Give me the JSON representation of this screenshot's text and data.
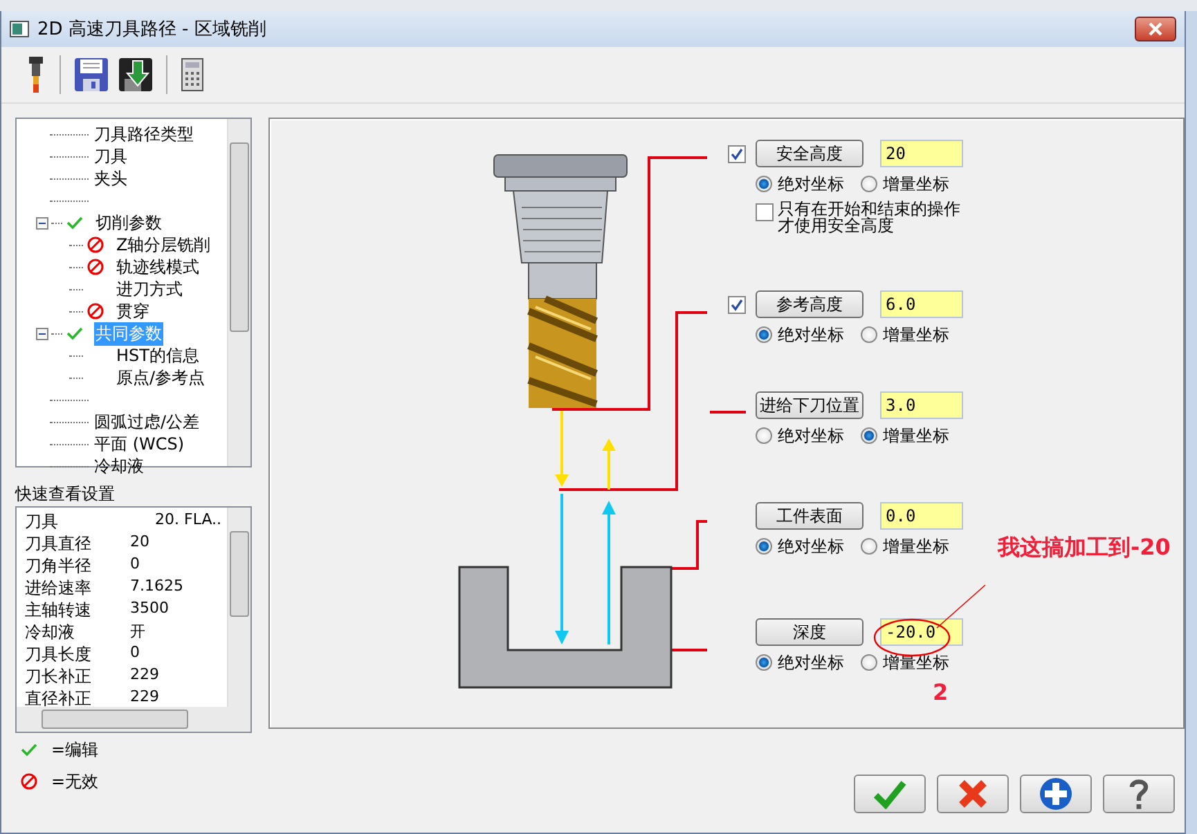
{
  "window": {
    "title": "2D 高速刀具路径 - 区域铣削"
  },
  "tree": {
    "items": [
      {
        "kind": "item",
        "label": "刀具路径类型",
        "edited": false
      },
      {
        "kind": "item",
        "label": "刀具",
        "edited": false
      },
      {
        "kind": "item",
        "label": "夹头",
        "edited": false
      },
      {
        "kind": "spacer"
      },
      {
        "kind": "item",
        "label": "切削参数",
        "edited": true,
        "expanded": true,
        "selected": false,
        "children": [
          {
            "label": "Z轴分层铣削",
            "invalid": true
          },
          {
            "label": "轨迹线模式",
            "invalid": true
          },
          {
            "label": "进刀方式",
            "invalid": false
          },
          {
            "label": "贯穿",
            "invalid": true
          }
        ]
      },
      {
        "kind": "item",
        "label": "共同参数",
        "edited": true,
        "expanded": true,
        "selected": true,
        "children": [
          {
            "label": "HST的信息",
            "invalid": false
          },
          {
            "label": "原点/参考点",
            "invalid": false
          }
        ]
      },
      {
        "kind": "spacer"
      },
      {
        "kind": "item",
        "label": "圆弧过虑/公差",
        "edited": false
      },
      {
        "kind": "item",
        "label": "平面 (WCS)",
        "edited": false
      },
      {
        "kind": "item",
        "label": "冷却液",
        "edited": false
      }
    ]
  },
  "quick_view": {
    "title": "快速查看设置",
    "rows": [
      {
        "name": "刀具",
        "value": "20. FLA.."
      },
      {
        "name": "刀具直径",
        "value": "20"
      },
      {
        "name": "刀角半径",
        "value": "0"
      },
      {
        "name": "进给速率",
        "value": "7.1625"
      },
      {
        "name": "主轴转速",
        "value": "3500"
      },
      {
        "name": "冷却液",
        "value": "开"
      },
      {
        "name": "刀具长度",
        "value": "0"
      },
      {
        "name": "刀长补正",
        "value": "229"
      },
      {
        "name": "直径补正",
        "value": "229"
      }
    ]
  },
  "legend": [
    {
      "kind": "edit",
      "label": "=编辑"
    },
    {
      "kind": "invalid",
      "label": "=无效"
    }
  ],
  "params": [
    {
      "label": "安全高度",
      "checked": true,
      "value": "20",
      "options": [
        {
          "label": "绝对坐标",
          "selected": true
        },
        {
          "label": "增量坐标",
          "selected": false
        }
      ],
      "extra_option": {
        "label": "只有在开始和结束的操作才使用安全高度",
        "checked": false
      }
    },
    {
      "label": "参考高度",
      "checked": true,
      "value": "6.0",
      "options": [
        {
          "label": "绝对坐标",
          "selected": true
        },
        {
          "label": "增量坐标",
          "selected": false
        }
      ]
    },
    {
      "label": "进给下刀位置",
      "value": "3.0",
      "options": [
        {
          "label": "绝对坐标",
          "selected": false
        },
        {
          "label": "增量坐标",
          "selected": true
        }
      ]
    },
    {
      "label": "工件表面",
      "value": "0.0",
      "options": [
        {
          "label": "绝对坐标",
          "selected": true
        },
        {
          "label": "增量坐标",
          "selected": false
        }
      ]
    },
    {
      "label": "深度",
      "value": "-20.0",
      "options": [
        {
          "label": "绝对坐标",
          "selected": true
        },
        {
          "label": "增量坐标",
          "selected": false
        }
      ]
    }
  ],
  "annotations": [
    {
      "kind": "note",
      "text": "我这搞加工到-20"
    },
    {
      "kind": "mark",
      "text": "2"
    }
  ],
  "buttons": [
    {
      "kind": "ok"
    },
    {
      "kind": "cancel"
    },
    {
      "kind": "add"
    },
    {
      "kind": "help"
    }
  ]
}
